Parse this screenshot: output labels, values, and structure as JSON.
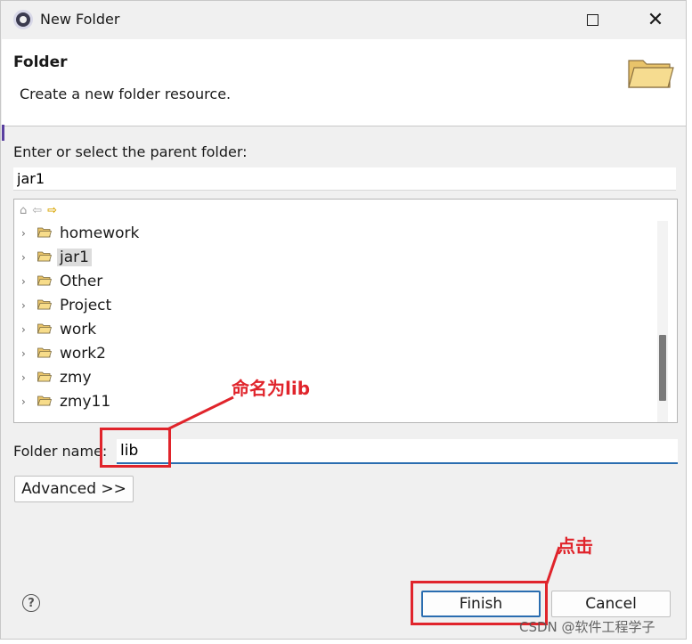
{
  "window": {
    "title": "New Folder"
  },
  "header": {
    "title": "Folder",
    "description": "Create a new folder resource."
  },
  "parent_folder": {
    "label": "Enter or select the parent folder:",
    "value": "jar1"
  },
  "tree": {
    "items": [
      {
        "label": "homework",
        "selected": false
      },
      {
        "label": "jar1",
        "selected": true
      },
      {
        "label": "Other",
        "selected": false
      },
      {
        "label": "Project",
        "selected": false
      },
      {
        "label": "work",
        "selected": false
      },
      {
        "label": "work2",
        "selected": false
      },
      {
        "label": "zmy",
        "selected": false
      },
      {
        "label": "zmy11",
        "selected": false
      }
    ]
  },
  "folder_name": {
    "label": "Folder name:",
    "value": "lib"
  },
  "buttons": {
    "advanced": "Advanced >>",
    "finish": "Finish",
    "cancel": "Cancel"
  },
  "annotations": {
    "name_note": "命名为lib",
    "finish_note": "点击",
    "color": "#e0242b"
  },
  "watermark": "CSDN @软件工程学子"
}
